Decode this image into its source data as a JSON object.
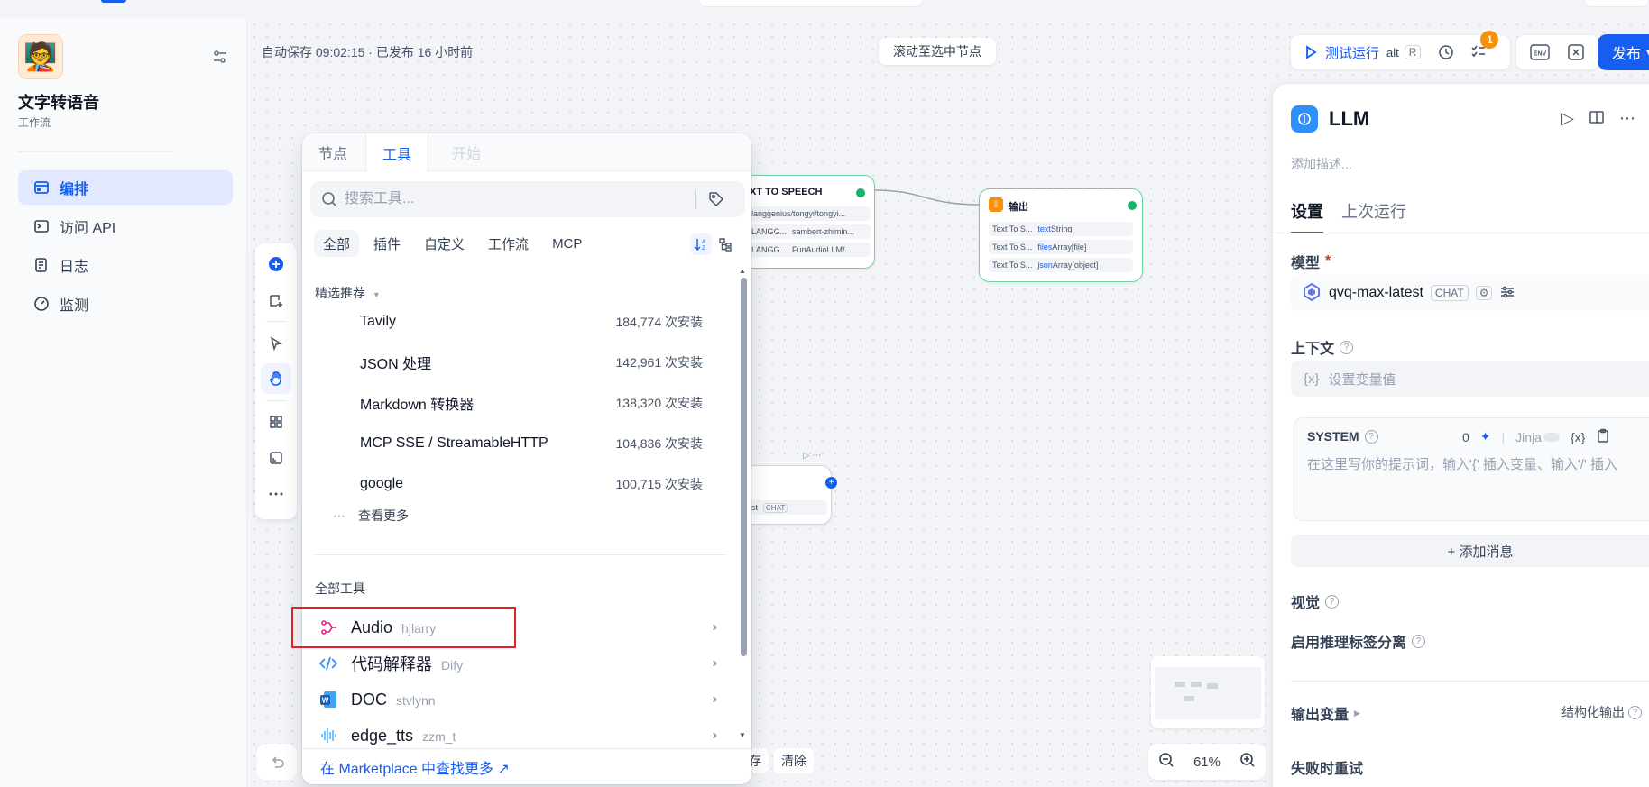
{
  "app": {
    "icon_emoji": "🧑‍🏫",
    "name": "文字转语音",
    "type": "工作流"
  },
  "nav": [
    {
      "label": "编排",
      "icon": "layout-icon",
      "active": true
    },
    {
      "label": "访问 API",
      "icon": "terminal-icon",
      "active": false
    },
    {
      "label": "日志",
      "icon": "log-icon",
      "active": false
    },
    {
      "label": "监测",
      "icon": "gauge-icon",
      "active": false
    }
  ],
  "canvas": {
    "autosave": "自动保存 09:02:15 · 已发布 16 小时前",
    "scroll_to_selected": "滚动至选中节点",
    "zoom": "61%",
    "bottom_buttons": [
      "存",
      "清除"
    ]
  },
  "toolbar": {
    "run_label": "测试运行",
    "run_kbd_alt": "alt",
    "run_kbd_key": "R",
    "checklist_badge": "1",
    "env_label": "ENV",
    "publish_label": "发布"
  },
  "nodes": {
    "tts": {
      "title": "XT TO SPEECH",
      "rows": [
        {
          "left": "",
          "right": "langgenius/tongyi/tongyi..."
        },
        {
          "left": "LANGG...",
          "right": "sambert-zhimin..."
        },
        {
          "left": "LANGG...",
          "right": "FunAudioLLM/..."
        }
      ]
    },
    "output": {
      "title": "输出",
      "rows": [
        {
          "src": "Text To S...",
          "var": "text",
          "type": "String"
        },
        {
          "src": "Text To S...",
          "var": "files",
          "type": "Array[file]"
        },
        {
          "src": "Text To S...",
          "var": "json",
          "type": "Array[object]"
        }
      ]
    },
    "llm": {
      "model_cut": "st",
      "chip": "CHAT"
    }
  },
  "picker": {
    "tabs": [
      {
        "label": "节点",
        "state": "normal"
      },
      {
        "label": "工具",
        "state": "active"
      },
      {
        "label": "开始",
        "state": "disabled"
      }
    ],
    "search_placeholder": "搜索工具...",
    "filters": [
      {
        "label": "全部",
        "active": true
      },
      {
        "label": "插件",
        "active": false
      },
      {
        "label": "自定义",
        "active": false
      },
      {
        "label": "工作流",
        "active": false
      },
      {
        "label": "MCP",
        "active": false
      }
    ],
    "featured_title": "精选推荐",
    "featured": [
      {
        "name": "Tavily",
        "count": "184,774 次安装"
      },
      {
        "name": "JSON 处理",
        "count": "142,961 次安装"
      },
      {
        "name": "Markdown 转换器",
        "count": "138,320 次安装"
      },
      {
        "name": "MCP SSE / StreamableHTTP",
        "count": "104,836 次安装"
      },
      {
        "name": "google",
        "count": "100,715 次安装"
      }
    ],
    "see_more": "查看更多",
    "all_tools_title": "全部工具",
    "tools": [
      {
        "name": "Audio",
        "author": "hjlarry",
        "icon": "audio-icon",
        "color": "#dd2590"
      },
      {
        "name": "代码解释器",
        "author": "Dify",
        "icon": "code-icon",
        "color": "#2e90fa"
      },
      {
        "name": "DOC",
        "author": "stvlynn",
        "icon": "word-doc-icon",
        "color": "#155eef"
      },
      {
        "name": "edge_tts",
        "author": "zzm_t",
        "icon": "waveform-icon",
        "color": "#53b1fd"
      }
    ],
    "footer_link": "在 Marketplace 中查找更多 ↗"
  },
  "panel": {
    "title": "LLM",
    "desc_placeholder": "添加描述...",
    "tabs": [
      {
        "label": "设置",
        "active": true
      },
      {
        "label": "上次运行",
        "active": false
      }
    ],
    "model_label": "模型",
    "model_required": "*",
    "model_name": "qvq-max-latest",
    "model_chip": "CHAT",
    "context_label": "上下文",
    "context_var_icon": "{x}",
    "context_placeholder": "设置变量值",
    "system_label": "SYSTEM",
    "system_count": "0",
    "jinja_label": "Jinja",
    "var_icon": "{x}",
    "system_placeholder": "在这里写你的提示词，输入'{' 插入变量、输入'/' 插入",
    "add_message": "+ 添加消息",
    "vision_label": "视觉",
    "reasoning_label": "启用推理标签分离",
    "output_vars_label": "输出变量",
    "structured_output": "结构化输出",
    "retry_label": "失败时重试"
  }
}
